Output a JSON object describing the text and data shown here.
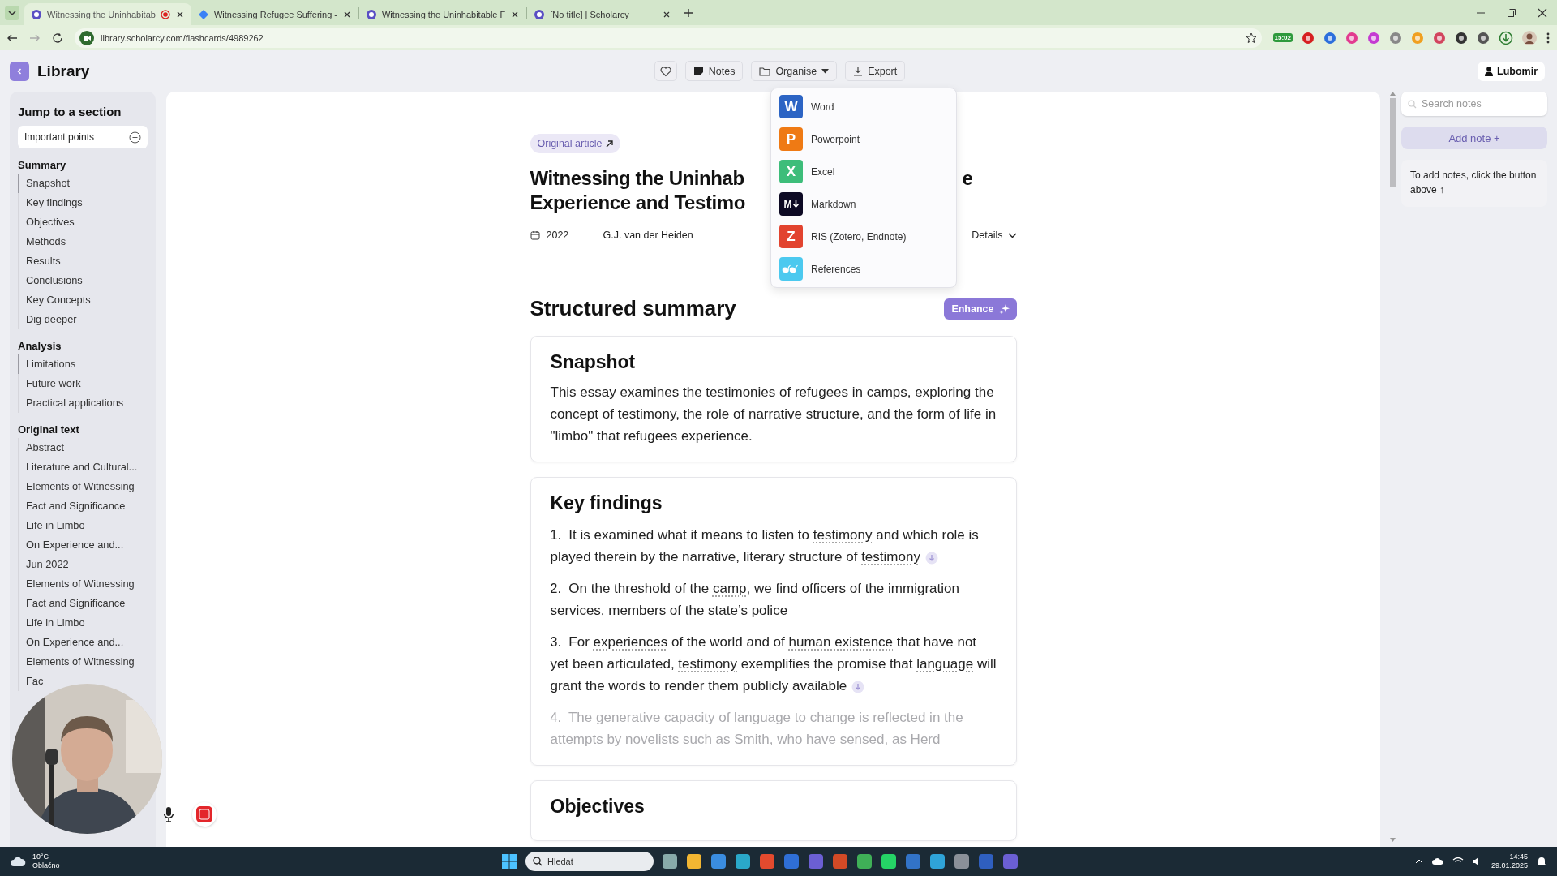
{
  "browser": {
    "tabs": [
      {
        "title": "Witnessing the Uninhabitab",
        "selected": true,
        "recording": true
      },
      {
        "title": "Witnessing Refugee Suffering -",
        "selected": false,
        "recording": false
      },
      {
        "title": "Witnessing the Uninhabitable F",
        "selected": false,
        "recording": false
      },
      {
        "title": "[No title] | Scholarcy",
        "selected": false,
        "recording": false
      }
    ],
    "url": "library.scholarcy.com/flashcards/4989262",
    "extension_badge": "15:02"
  },
  "header": {
    "title": "Library",
    "toolbar": [
      {
        "kind": "favorite"
      },
      {
        "kind": "notes",
        "label": "Notes"
      },
      {
        "kind": "organise",
        "label": "Organise"
      },
      {
        "kind": "export",
        "label": "Export"
      }
    ],
    "user": "Lubomir"
  },
  "export_menu": [
    {
      "kind": "letter",
      "badge": "W",
      "label": "Word",
      "color": "#2c64c4"
    },
    {
      "kind": "letter",
      "badge": "P",
      "label": "Powerpoint",
      "color": "#ef7a14"
    },
    {
      "kind": "letter",
      "badge": "X",
      "label": "Excel",
      "color": "#3dbd7a"
    },
    {
      "kind": "markdown",
      "badge": "M",
      "label": "Markdown",
      "color": "#0d0a24"
    },
    {
      "kind": "letter",
      "badge": "Z",
      "label": "RIS (Zotero, Endnote)",
      "color": "#e2432f"
    },
    {
      "kind": "quote",
      "label": "References",
      "color": "#4cc9ef"
    }
  ],
  "sidebar": {
    "title": "Jump to a section",
    "important": "Important points",
    "sections": [
      {
        "title": "Summary",
        "items": [
          {
            "label": "Snapshot",
            "selected": true
          },
          {
            "label": "Key findings",
            "selected": false
          },
          {
            "label": "Objectives",
            "selected": false
          },
          {
            "label": "Methods",
            "selected": false
          },
          {
            "label": "Results",
            "selected": false
          },
          {
            "label": "Conclusions",
            "selected": false
          },
          {
            "label": "Key Concepts",
            "selected": false
          },
          {
            "label": "Dig deeper",
            "selected": false
          }
        ]
      },
      {
        "title": "Analysis",
        "items": [
          {
            "label": "Limitations",
            "selected": true
          },
          {
            "label": "Future work",
            "selected": false
          },
          {
            "label": "Practical applications",
            "selected": false
          }
        ]
      },
      {
        "title": "Original text",
        "items": [
          {
            "label": "Abstract",
            "selected": false
          },
          {
            "label": "Literature and Cultural...",
            "selected": false
          },
          {
            "label": "Elements of Witnessing",
            "selected": false
          },
          {
            "label": "Fact and Significance",
            "selected": false
          },
          {
            "label": "Life in Limbo",
            "selected": false
          },
          {
            "label": "On Experience and...",
            "selected": false
          },
          {
            "label": "Jun 2022",
            "selected": false
          },
          {
            "label": "Elements of Witnessing",
            "selected": false
          },
          {
            "label": "Fact and Significance",
            "selected": false
          },
          {
            "label": "Life in Limbo",
            "selected": false
          },
          {
            "label": "On Experience and...",
            "selected": false
          },
          {
            "label": "Elements of Witnessing",
            "selected": false
          },
          {
            "label": "Fac",
            "selected": false
          }
        ]
      }
    ]
  },
  "article": {
    "original_link": "Original article",
    "title_line_1_start": "Witnessing the Uninhab",
    "title_line_1_end": "e",
    "title_line_2": "Experience and Testimo",
    "year": "2022",
    "author": "G.J. van der Heiden",
    "details": "Details",
    "summary_heading": "Structured summary",
    "enhance": "Enhance",
    "snapshot": {
      "title": "Snapshot",
      "text": "This essay examines the testimonies of refugees in camps, exploring the concept of testimony, the role of narrative structure, and the form of life in \"limbo\" that refugees experience."
    },
    "key_findings": {
      "title": "Key findings",
      "items": [
        {
          "number": "1.",
          "faded": false,
          "source": true,
          "parts": [
            {
              "text": "It is examined what it means to listen to ",
              "term": false
            },
            {
              "text": "testimony",
              "term": true
            },
            {
              "text": " and which role is played therein by the narrative, literary structure of ",
              "term": false
            },
            {
              "text": "testimony",
              "term": true
            }
          ]
        },
        {
          "number": "2.",
          "faded": false,
          "source": false,
          "parts": [
            {
              "text": "On the threshold of the ",
              "term": false
            },
            {
              "text": "camp",
              "term": true
            },
            {
              "text": ", we find officers of the immigration services, members of the state’s police",
              "term": false
            }
          ]
        },
        {
          "number": "3.",
          "faded": false,
          "source": true,
          "parts": [
            {
              "text": "For ",
              "term": false
            },
            {
              "text": "experiences",
              "term": true
            },
            {
              "text": " of the world and of ",
              "term": false
            },
            {
              "text": "human existence",
              "term": true
            },
            {
              "text": " that have not yet been articulated, ",
              "term": false
            },
            {
              "text": "testimony",
              "term": true
            },
            {
              "text": " exemplifies the promise that ",
              "term": false
            },
            {
              "text": "language",
              "term": true
            },
            {
              "text": " will grant the words to render them publicly available",
              "term": false
            }
          ]
        },
        {
          "number": "4.",
          "faded": true,
          "source": false,
          "parts": [
            {
              "text": "The generative capacity of language to change is reflected in the attempts by novelists such as Smith, who have sensed, as Herd",
              "term": false
            }
          ]
        }
      ]
    },
    "objectives": {
      "title": "Objectives"
    }
  },
  "notes": {
    "search": {
      "placeholder": "Search notes"
    },
    "add_button": "Add note +",
    "hint": "To add notes, click the button above ↑"
  },
  "taskbar": {
    "weather": {
      "temp": "10°C",
      "condition": "Oblačno"
    },
    "search": {
      "placeholder": "Hledat"
    },
    "clock": {
      "time": "14:45",
      "date": "29.01.2025"
    }
  }
}
